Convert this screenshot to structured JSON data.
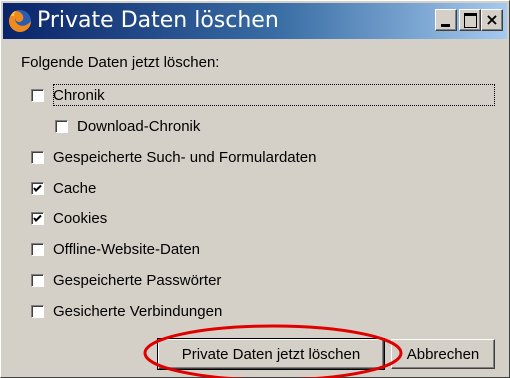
{
  "window": {
    "title": "Private Daten löschen",
    "icon": "firefox-icon"
  },
  "titlebar": {
    "minimize_icon": "minimize-icon",
    "maximize_icon": "maximize-icon",
    "close_label": "×"
  },
  "dialog": {
    "heading": "Folgende Daten jetzt löschen:",
    "options": [
      {
        "label": "Chronik",
        "checked": false
      },
      {
        "label": "Download-Chronik",
        "checked": false
      },
      {
        "label": "Gespeicherte Such- und Formulardaten",
        "checked": false
      },
      {
        "label": "Cache",
        "checked": true
      },
      {
        "label": "Cookies",
        "checked": true
      },
      {
        "label": "Offline-Website-Daten",
        "checked": false
      },
      {
        "label": "Gespeicherte Passwörter",
        "checked": false
      },
      {
        "label": "Gesicherte Verbindungen",
        "checked": false
      }
    ],
    "buttons": {
      "confirm": "Private Daten jetzt löschen",
      "cancel": "Abbrechen"
    }
  },
  "colors": {
    "annotation": "#e00000",
    "titlebar_start": "#0a246a",
    "titlebar_end": "#a6caf0"
  }
}
